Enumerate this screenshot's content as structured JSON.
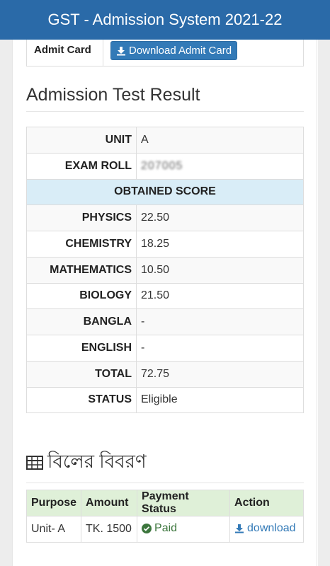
{
  "header": {
    "title": "GST - Admission System 2021-22"
  },
  "admit_card": {
    "label": "Admit Card",
    "button_label": "Download Admit Card"
  },
  "result": {
    "title": "Admission Test Result",
    "unit_label": "UNIT",
    "unit_value": "A",
    "roll_label": "EXAM ROLL",
    "roll_value": "207005",
    "obtained_label": "OBTAINED SCORE",
    "rows": [
      {
        "label": "PHYSICS",
        "value": "22.50"
      },
      {
        "label": "CHEMISTRY",
        "value": "18.25"
      },
      {
        "label": "MATHEMATICS",
        "value": "10.50"
      },
      {
        "label": "BIOLOGY",
        "value": "21.50"
      },
      {
        "label": "BANGLA",
        "value": "-"
      },
      {
        "label": "ENGLISH",
        "value": "-"
      },
      {
        "label": "TOTAL",
        "value": "72.75"
      },
      {
        "label": "STATUS",
        "value": "Eligible"
      }
    ]
  },
  "bill": {
    "title": "বিলের বিবরণ",
    "headers": [
      "Purpose",
      "Amount",
      "Payment Status",
      "Action"
    ],
    "row": {
      "purpose": "Unit- A",
      "amount": "TK. 1500",
      "status": "Paid",
      "action": "download"
    }
  },
  "icons": {
    "download": "download-icon",
    "table": "table-icon",
    "check": "check-circle-icon"
  },
  "colors": {
    "topbar": "#2a6aa8",
    "primary": "#337ab7",
    "info": "#d9edf7",
    "success_bg": "#dff0d8",
    "success": "#3c763d"
  }
}
